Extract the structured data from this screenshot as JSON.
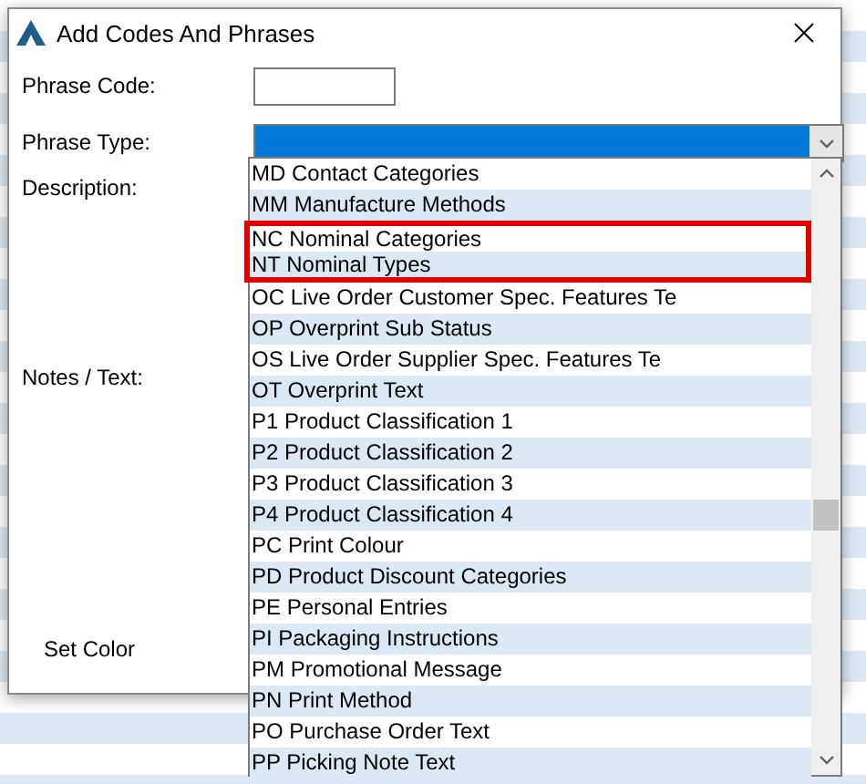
{
  "window": {
    "title": "Add Codes And Phrases"
  },
  "form": {
    "phrase_code_label": "Phrase Code:",
    "phrase_type_label": "Phrase Type:",
    "description_label": "Description:",
    "notes_label": "Notes / Text:",
    "set_color_label": "Set Color"
  },
  "phrase_type_dropdown": {
    "expanded": true,
    "items": [
      {
        "label": "MD Contact Categories",
        "highlighted": false
      },
      {
        "label": "MM Manufacture Methods",
        "highlighted": false
      },
      {
        "label": "NC Nominal Categories",
        "highlighted": true
      },
      {
        "label": "NT Nominal Types",
        "highlighted": true
      },
      {
        "label": "OC Live Order Customer Spec. Features Te",
        "highlighted": false
      },
      {
        "label": "OP Overprint Sub Status",
        "highlighted": false
      },
      {
        "label": "OS Live Order Supplier Spec. Features Te",
        "highlighted": false
      },
      {
        "label": "OT Overprint Text",
        "highlighted": false
      },
      {
        "label": "P1 Product Classification 1",
        "highlighted": false
      },
      {
        "label": "P2 Product Classification 2",
        "highlighted": false
      },
      {
        "label": "P3 Product Classification 3",
        "highlighted": false
      },
      {
        "label": "P4 Product Classification 4",
        "highlighted": false
      },
      {
        "label": "PC Print Colour",
        "highlighted": false
      },
      {
        "label": "PD Product Discount Categories",
        "highlighted": false
      },
      {
        "label": "PE Personal Entries",
        "highlighted": false
      },
      {
        "label": "PI Packaging Instructions",
        "highlighted": false
      },
      {
        "label": "PM Promotional Message",
        "highlighted": false
      },
      {
        "label": "PN Print Method",
        "highlighted": false
      },
      {
        "label": "PO Purchase Order Text",
        "highlighted": false
      },
      {
        "label": "PP Picking Note Text",
        "highlighted": false
      }
    ]
  }
}
